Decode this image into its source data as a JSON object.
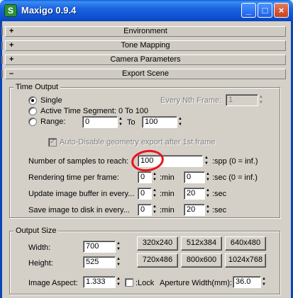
{
  "window": {
    "title": "Maxigo 0.9.4",
    "icon": "S"
  },
  "titlebar_buttons": {
    "minimize": "_",
    "maximize": "□",
    "close": "×"
  },
  "rollouts": [
    {
      "sign": "+",
      "label": "Environment"
    },
    {
      "sign": "+",
      "label": "Tone Mapping"
    },
    {
      "sign": "+",
      "label": "Camera Parameters"
    },
    {
      "sign": "–",
      "label": "Export Scene"
    }
  ],
  "time_output": {
    "title": "Time Output",
    "single_label": "Single",
    "active_segment_label": "Active Time Segment: 0 To 100",
    "range_label": "Range:",
    "range_from": "0",
    "range_to_label": "To",
    "range_to": "100",
    "every_nth_label": "Every Nth Frame:",
    "every_nth_value": "1",
    "selected": "single"
  },
  "auto_disable": {
    "label": "Auto-Disable geometry export after 1st frame",
    "checked": true
  },
  "samples": {
    "label": "Number of samples to reach:",
    "value": "100",
    "unit": ":spp  (0 = inf.)"
  },
  "rendering_time": {
    "label": "Rendering time per frame:",
    "minutes": "0",
    "min_label": ":min",
    "seconds": "0",
    "unit": ":sec  (0 = inf.)"
  },
  "update_buffer": {
    "label": "Update image buffer in every...",
    "minutes": "0",
    "min_label": ":min",
    "seconds": "20",
    "unit": ":sec"
  },
  "save_image": {
    "label": "Save image to disk in every...",
    "minutes": "0",
    "min_label": ":min",
    "seconds": "20",
    "unit": ":sec"
  },
  "output_size": {
    "title": "Output Size",
    "width_label": "Width:",
    "width": "700",
    "height_label": "Height:",
    "height": "525",
    "presets": [
      "320x240",
      "512x384",
      "640x480",
      "720x486",
      "800x600",
      "1024x768"
    ],
    "aspect_label": "Image Aspect:",
    "aspect": "1.333",
    "lock_label": ":Lock",
    "aperture_label": "Aperture Width(mm):",
    "aperture": "36.0"
  },
  "annotation": {
    "color": "#e8141c"
  },
  "colors": {
    "titlebar": "#0c4fd0",
    "face": "#d4d0c8"
  }
}
